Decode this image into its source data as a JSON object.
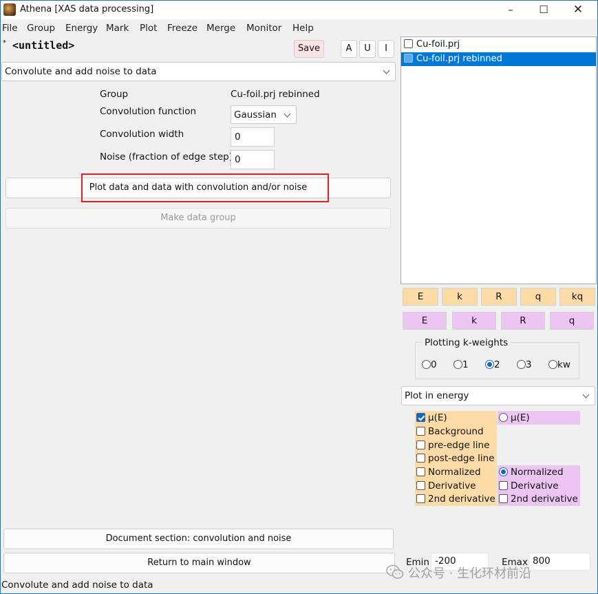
{
  "window": {
    "title": "Athena [XAS data processing]"
  },
  "menu": [
    "File",
    "Group",
    "Energy",
    "Mark",
    "Plot",
    "Freeze",
    "Merge",
    "Monitor",
    "Help"
  ],
  "project": {
    "marker": "*",
    "name": "<untitled>"
  },
  "toolbar": {
    "save": "Save",
    "a": "A",
    "u": "U",
    "i": "I"
  },
  "tool_select": {
    "value": "Convolute and add noise to data"
  },
  "form": {
    "group_label": "Group",
    "group_value": "Cu-foil.prj rebinned",
    "conv_func_label": "Convolution function",
    "conv_func_value": "Gaussian",
    "conv_width_label": "Convolution width",
    "conv_width_value": "0",
    "noise_label": "Noise (fraction of edge step)",
    "noise_value": "0"
  },
  "buttons": {
    "plot": "Plot data and data with convolution and/or noise",
    "make_group": "Make data group",
    "document": "Document section: convolution and noise",
    "return_main": "Return to main window"
  },
  "group_list": [
    {
      "name": "Cu-foil.prj",
      "selected": false
    },
    {
      "name": "Cu-foil.prj rebinned",
      "selected": true
    }
  ],
  "plot_buttons": {
    "orange": [
      "E",
      "k",
      "R",
      "q",
      "kq"
    ],
    "purple": [
      "E",
      "k",
      "R",
      "q"
    ]
  },
  "kweights": {
    "title": "Plotting k-weights",
    "options": [
      "0",
      "1",
      "2",
      "3",
      "kw"
    ],
    "selected": "2"
  },
  "plot_mode": {
    "value": "Plot in energy"
  },
  "energy_options": {
    "left": [
      {
        "label": "μ(E)",
        "checked": true
      },
      {
        "label": "Background",
        "checked": false
      },
      {
        "label": "pre-edge line",
        "checked": false
      },
      {
        "label": "post-edge line",
        "checked": false
      },
      {
        "label": "Normalized",
        "checked": false
      },
      {
        "label": "Derivative",
        "checked": false
      },
      {
        "label": "2nd derivative",
        "checked": false
      }
    ],
    "right": {
      "mu": "μ(E)",
      "normalized": "Normalized",
      "derivative": "Derivative",
      "second_derivative": "2nd derivative",
      "selected": "Normalized"
    }
  },
  "range": {
    "emin_label": "Emin",
    "emin_value": "-200",
    "emax_label": "Emax",
    "emax_value": "800"
  },
  "status": "Convolute and add noise to data",
  "watermark": "公众号 · 生化环材前沿",
  "colors": {
    "highlight": "#0078d7",
    "orange": "#fddba6",
    "purple": "#ecc5f2",
    "annotation": "#e02020"
  }
}
